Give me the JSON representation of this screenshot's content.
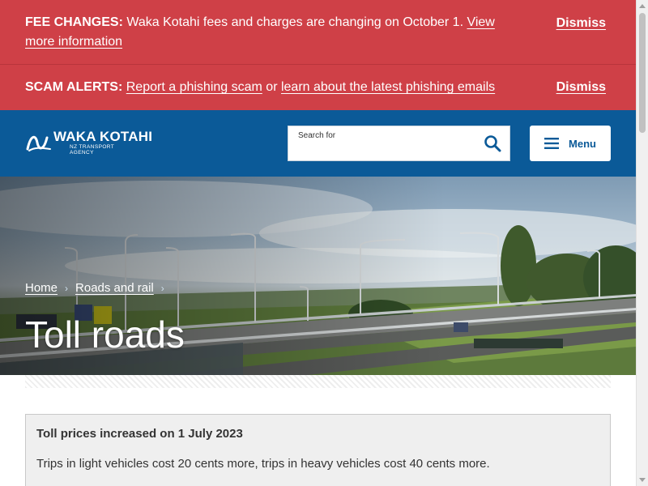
{
  "alerts": {
    "fee": {
      "heading": "FEE CHANGES:",
      "text": " Waka Kotahi fees and charges are changing on October 1. ",
      "link": "View more information",
      "dismiss": "Dismiss"
    },
    "scam": {
      "heading": "SCAM ALERTS:",
      "link1": "Report a phishing scam",
      "joiner": " or ",
      "link2": "learn about the latest phishing emails",
      "dismiss": "Dismiss"
    }
  },
  "header": {
    "logo": {
      "title": "WAKA KOTAHI",
      "subtitle1": "NZ TRANSPORT",
      "subtitle2": "AGENCY"
    },
    "search": {
      "label": "Search for",
      "value": "",
      "icon": "search-icon"
    },
    "menu": {
      "label": "Menu",
      "icon": "hamburger-icon"
    }
  },
  "hero": {
    "breadcrumb": [
      {
        "label": "Home"
      },
      {
        "label": "Roads and rail"
      }
    ],
    "title": "Toll roads"
  },
  "notice": {
    "title": "Toll prices increased on 1 July 2023",
    "body": "Trips in light vehicles cost 20 cents more, trips in heavy vehicles cost 40 cents more."
  },
  "colors": {
    "alert_red": "#cf4047",
    "header_blue": "#0b5a98",
    "notice_bg": "#efefef"
  }
}
